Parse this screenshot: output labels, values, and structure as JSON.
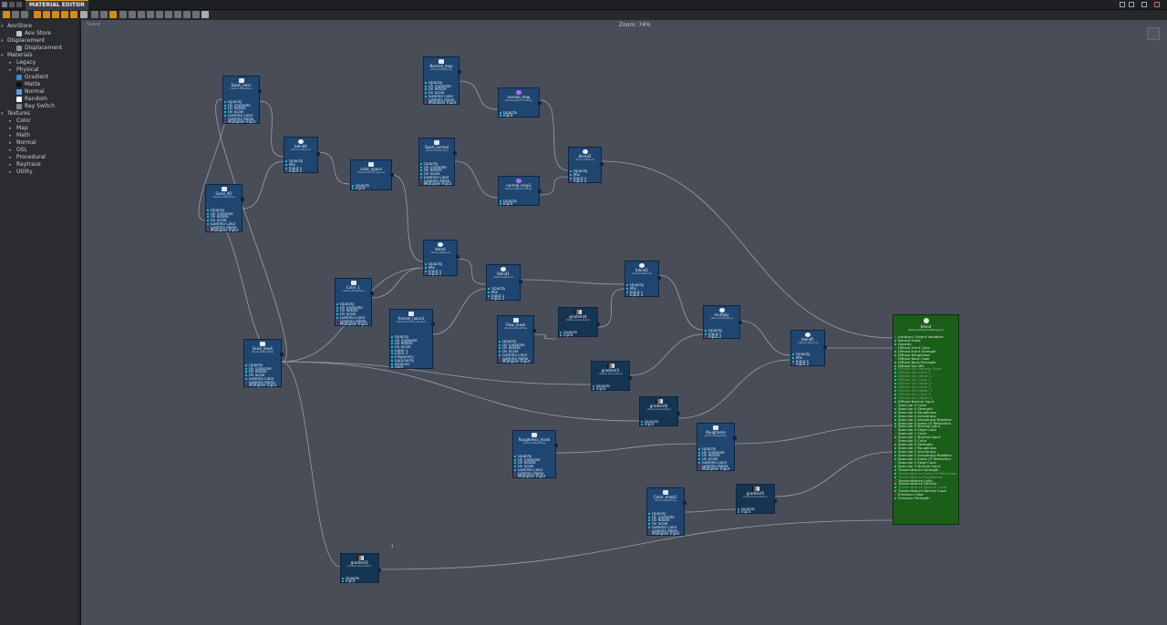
{
  "window": {
    "tab_label": "MATERIAL EDITOR",
    "new_tab_glyph": "+"
  },
  "canvas": {
    "zoom_label": "Zoom: 74%",
    "canvas_label": "Scene",
    "corner_marker": "1"
  },
  "sidebar": {
    "items": [
      {
        "label": "AovStore",
        "arrow": "▾"
      },
      {
        "label": "Aov Store",
        "icon": "aov-store-icon",
        "icon_color": "#bfc4ca"
      },
      {
        "label": "Displacement",
        "arrow": "▾"
      },
      {
        "label": "Displacement",
        "icon": "displacement-icon",
        "icon_color": "#8c95a1"
      },
      {
        "label": "Materials",
        "arrow": "▾"
      },
      {
        "label": "Legacy",
        "arrow": "▸"
      },
      {
        "label": "Physical",
        "arrow": "▸"
      },
      {
        "label": "Gradient",
        "icon": "gradient-material-icon",
        "icon_color": "#3b8ad6"
      },
      {
        "label": "Matte",
        "icon": "matte-icon",
        "icon_color": "#111111"
      },
      {
        "label": "Normal",
        "icon": "normal-material-icon",
        "icon_color": "#5aa0f0"
      },
      {
        "label": "Random",
        "icon": "random-icon",
        "icon_color": "#ffffff"
      },
      {
        "label": "Ray Switch",
        "icon": "ray-switch-icon",
        "icon_color": "#7d8590"
      },
      {
        "label": "Textures",
        "arrow": "▾"
      },
      {
        "label": "Color",
        "arrow": "▸"
      },
      {
        "label": "Map",
        "arrow": "▸"
      },
      {
        "label": "Math",
        "arrow": "▸"
      },
      {
        "label": "Normal",
        "arrow": "▸"
      },
      {
        "label": "OSL",
        "arrow": "▸"
      },
      {
        "label": "Procedural",
        "arrow": "▸"
      },
      {
        "label": "Raytrace",
        "arrow": "▸"
      },
      {
        "label": "Utility",
        "arrow": "▸"
      }
    ]
  },
  "nodes": [
    {
      "title": "Sand_color",
      "sub": "(TextureMapFile)",
      "kind": "tex",
      "ports": [
        "Opacity",
        "Uv Translate",
        "Uv Rotate",
        "Uv Scale",
        "Gamma Color",
        "Gamma Alpha",
        "Multiplier Input"
      ]
    },
    {
      "title": "Sand_AO",
      "sub": "(TextureMapFile)",
      "kind": "tex",
      "ports": [
        "Opacity",
        "Uv Translate",
        "Uv Rotate",
        "Uv Scale",
        "Gamma Color",
        "Gamma Alpha",
        "Multiplier Input"
      ]
    },
    {
      "title": "blend4",
      "sub": "(TextureBlend)",
      "kind": "blend",
      "ports": [
        "Opacity",
        "Mix",
        "Input 1",
        "Input 2"
      ]
    },
    {
      "title": "color_space",
      "sub": "(TextureColorSpace)",
      "kind": "tex",
      "ports": [
        "Opacity",
        "Input"
      ]
    },
    {
      "title": "Normal_map",
      "sub": "(TextureMapFile)",
      "kind": "tex",
      "ports": [
        "Opacity",
        "Uv Translate",
        "Uv Rotate",
        "Uv Scale",
        "Gamma Color",
        "Gamma Alpha",
        "Multiplier Input"
      ]
    },
    {
      "title": "normal_map",
      "sub": "(TextureNormalMap)",
      "kind": "sphere",
      "ports": [
        "Opacity",
        "Input"
      ]
    },
    {
      "title": "Sand_normal",
      "sub": "(TextureMapFile)",
      "kind": "tex",
      "ports": [
        "Opacity",
        "Uv Translate",
        "Uv Rotate",
        "Uv Scale",
        "Gamma Color",
        "Gamma Alpha",
        "Multiplier Input"
      ]
    },
    {
      "title": "normal_map1",
      "sub": "(TextureNormalMap)",
      "kind": "sphere",
      "ports": [
        "Opacity",
        "Input"
      ]
    },
    {
      "title": "blend3",
      "sub": "(TextureBlend)",
      "kind": "blend",
      "ports": [
        "Opacity",
        "Mix",
        "Input 1",
        "Input 2"
      ]
    },
    {
      "title": "blend",
      "sub": "(TextureBlend)",
      "kind": "blend",
      "ports": [
        "Opacity",
        "Mix",
        "Input 1",
        "Input 2"
      ]
    },
    {
      "title": "Color_1",
      "sub": "(TextureMapFile)",
      "kind": "tex",
      "ports": [
        "Opacity",
        "Uv Translate",
        "Uv Rotate",
        "Uv Scale",
        "Gamma Color",
        "Gamma Alpha",
        "Multiplier Input"
      ]
    },
    {
      "title": "blend1",
      "sub": "(TextureBlend)",
      "kind": "blend",
      "ports": [
        "Opacity",
        "Mix",
        "Input 1",
        "Input 2"
      ]
    },
    {
      "title": "fresnel_noise1",
      "sub": "(TextureFresnelNoise)",
      "kind": "tex",
      "ports": [
        "Opacity",
        "Uv Translate",
        "Uv Rotate",
        "Uv Scale",
        "Color 1",
        "Color 2",
        "Frequency",
        "Lacunarity",
        "Octaves",
        "Gain"
      ]
    },
    {
      "title": "Flow_mask",
      "sub": "(TextureMapFile)",
      "kind": "tex",
      "ports": [
        "Opacity",
        "Uv Translate",
        "Uv Rotate",
        "Uv Scale",
        "Gamma Color",
        "Gamma Alpha",
        "Multiplier Input"
      ]
    },
    {
      "title": "gradient4",
      "sub": "(TextureGradient)",
      "kind": "grad",
      "ports": [
        "Opacity",
        "Input"
      ]
    },
    {
      "title": "blend2",
      "sub": "(TextureBlend)",
      "kind": "blend",
      "ports": [
        "Opacity",
        "Mix",
        "Input 1",
        "Input 2"
      ]
    },
    {
      "title": "multiply",
      "sub": "(TextureMultiply)",
      "kind": "blend",
      "ports": [
        "Opacity",
        "Input 1",
        "Input 2"
      ]
    },
    {
      "title": "Sand_mask",
      "sub": "(TextureMapFile)",
      "kind": "tex",
      "ports": [
        "Opacity",
        "Uv Translate",
        "Uv Rotate",
        "Uv Scale",
        "Gamma Color",
        "Gamma Alpha",
        "Multiplier Input"
      ]
    },
    {
      "title": "gradient3",
      "sub": "(TextureGradient)",
      "kind": "grad",
      "ports": [
        "Opacity",
        "Input"
      ]
    },
    {
      "title": "blend5",
      "sub": "(TextureBlend)",
      "kind": "blend",
      "ports": [
        "Opacity",
        "Mix",
        "Input 1",
        "Input 2"
      ]
    },
    {
      "title": "gradient6",
      "sub": "(TextureGradient)",
      "kind": "grad",
      "ports": [
        "Opacity",
        "Input"
      ]
    },
    {
      "title": "Roughness_mask",
      "sub": "(TextureMapFile)",
      "kind": "tex",
      "ports": [
        "Opacity",
        "Uv Translate",
        "Uv Rotate",
        "Uv Scale",
        "Gamma Color",
        "Gamma Alpha",
        "Multiplier Input"
      ]
    },
    {
      "title": "Roughness",
      "sub": "(TextureMapFile)",
      "kind": "tex",
      "ports": [
        "Opacity",
        "Uv Translate",
        "Uv Rotate",
        "Uv Scale",
        "Gamma Color",
        "Gamma Alpha",
        "Multiplier Input"
      ]
    },
    {
      "title": "Color_mask1",
      "sub": "(TextureMapFile)",
      "kind": "tex",
      "ports": [
        "Opacity",
        "Uv Translate",
        "Uv Rotate",
        "Uv Scale",
        "Gamma Color",
        "Gamma Alpha",
        "Multiplier Input"
      ]
    },
    {
      "title": "gradient5",
      "sub": "(TextureGradient)",
      "kind": "grad",
      "ports": [
        "Opacity",
        "Input"
      ]
    },
    {
      "title": "gradient1",
      "sub": "(TextureGradient)",
      "kind": "grad",
      "ports": [
        "Opacity",
        "Input"
      ]
    }
  ],
  "output_node": {
    "title": "blend",
    "sub": "(MaterialPhysicalNetwork)",
    "ports": [
      {
        "label": "Arbitrary Output Variables",
        "kind": "b"
      },
      {
        "label": "Normal Input",
        "kind": "c"
      },
      {
        "label": "Opacity",
        "kind": "c"
      },
      {
        "label": "Diffuse Front Color",
        "kind": "r"
      },
      {
        "label": "Diffuse Front Strength",
        "kind": "c"
      },
      {
        "label": "Diffuse Roughness",
        "kind": "c"
      },
      {
        "label": "Diffuse Back Color",
        "kind": "r"
      },
      {
        "label": "Diffuse Back Strength",
        "kind": "c"
      },
      {
        "label": "Diffuse Sss Mix",
        "kind": "c"
      },
      {
        "label": "Diffuse Sss Density Scale",
        "kind": "dim"
      },
      {
        "label": "Diffuse Sss Color 1",
        "kind": "dim"
      },
      {
        "label": "Diffuse Sss Depth 1",
        "kind": "dim"
      },
      {
        "label": "Diffuse Sss Color 2",
        "kind": "dim"
      },
      {
        "label": "Diffuse Sss Depth 2",
        "kind": "dim"
      },
      {
        "label": "Diffuse Sss Color 3",
        "kind": "dim"
      },
      {
        "label": "Diffuse Sss Depth 3",
        "kind": "dim"
      },
      {
        "label": "Diffuse Sss Color 4",
        "kind": "dim"
      },
      {
        "label": "Diffuse Sss Depth 4",
        "kind": "dim"
      },
      {
        "label": "Diffuse Normal Input",
        "kind": "c"
      },
      {
        "label": "Specular 0 Color",
        "kind": "r"
      },
      {
        "label": "Specular 0 Strength",
        "kind": "c"
      },
      {
        "label": "Specular 0 Roughness",
        "kind": "c"
      },
      {
        "label": "Specular 0 Anisotropy",
        "kind": "c"
      },
      {
        "label": "Specular 0 Anisotropy Rotation",
        "kind": "c"
      },
      {
        "label": "Specular 0 Index Of Refraction",
        "kind": "c"
      },
      {
        "label": "Specular 0 Normal Input",
        "kind": "c"
      },
      {
        "label": "Specular 0 Edge Color",
        "kind": "r"
      },
      {
        "label": "Specular 1 Color",
        "kind": "r"
      },
      {
        "label": "Specular 1 Normal Input",
        "kind": "c"
      },
      {
        "label": "Specular 2 Color",
        "kind": "r"
      },
      {
        "label": "Specular 2 Strength",
        "kind": "c"
      },
      {
        "label": "Specular 2 Roughness",
        "kind": "c"
      },
      {
        "label": "Specular 2 Anisotropy",
        "kind": "c"
      },
      {
        "label": "Specular 2 Anisotropy Rotation",
        "kind": "c"
      },
      {
        "label": "Specular 2 Index Of Refraction",
        "kind": "c"
      },
      {
        "label": "Specular 2 Edge Color",
        "kind": "r"
      },
      {
        "label": "Specular 2 Normal Input",
        "kind": "c"
      },
      {
        "label": "Transmittance Strength",
        "kind": "c"
      },
      {
        "label": "Transmittance Index Of Refraction",
        "kind": "dim"
      },
      {
        "label": "Transmittance Roughness",
        "kind": "dim"
      },
      {
        "label": "Transmittance Color",
        "kind": "r"
      },
      {
        "label": "Transmittance Density",
        "kind": "c"
      },
      {
        "label": "Transmittance Volume Color",
        "kind": "dim"
      },
      {
        "label": "Transmittance Normal Input",
        "kind": "c"
      },
      {
        "label": "Emission Color",
        "kind": "r"
      },
      {
        "label": "Emission Strength",
        "kind": "c"
      }
    ]
  },
  "colors": {
    "accent": "#e49a1e",
    "canvas": "#484d57",
    "node": "#1f4670",
    "output_node": "#1a5e1a",
    "wire": "#9aa0a8"
  }
}
